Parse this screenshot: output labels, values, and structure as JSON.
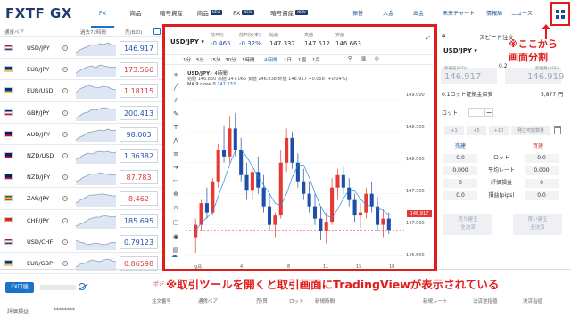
{
  "brand": {
    "logo": "FXTF GX"
  },
  "nav": {
    "tabs": [
      {
        "label": "FX",
        "badge": ""
      },
      {
        "label": "商品",
        "badge": ""
      },
      {
        "label": "暗号資産",
        "badge": ""
      },
      {
        "label": "商品",
        "badge": "NEW"
      },
      {
        "label": "FX",
        "badge": "NEW"
      },
      {
        "label": "暗号資産",
        "badge": "NEW"
      }
    ],
    "right_links": [
      "振替",
      "入金",
      "出金",
      "未来チャート",
      "情報局",
      "ニュース"
    ]
  },
  "rate_list": {
    "headers": {
      "pair": "通貨ペア",
      "chart": "過去72時間",
      "bid": "売(BID)"
    },
    "rows": [
      {
        "pair": "USD/JPY",
        "price": "146.917",
        "dir": "up",
        "flag": "us",
        "spark": [
          3,
          6,
          8,
          10,
          12,
          11,
          13,
          12,
          14,
          11,
          12
        ]
      },
      {
        "pair": "EUR/JPY",
        "price": "173.566",
        "dir": "dn",
        "flag": "eu",
        "spark": [
          4,
          7,
          9,
          11,
          12,
          10,
          13,
          12,
          11,
          10,
          11
        ]
      },
      {
        "pair": "EUR/USD",
        "price": "1.18115",
        "dir": "dn",
        "flag": "eu",
        "spark": [
          6,
          10,
          12,
          14,
          13,
          11,
          12,
          13,
          12,
          10,
          9
        ]
      },
      {
        "pair": "GBP/JPY",
        "price": "200.413",
        "dir": "up",
        "flag": "gb",
        "spark": [
          3,
          5,
          8,
          9,
          12,
          11,
          13,
          14,
          13,
          12,
          13
        ]
      },
      {
        "pair": "AUD/JPY",
        "price": "98.003",
        "dir": "up",
        "flag": "au",
        "spark": [
          2,
          5,
          7,
          10,
          11,
          12,
          13,
          12,
          14,
          12,
          13
        ]
      },
      {
        "pair": "NZD/USD",
        "price": "1.36382",
        "dir": "up",
        "flag": "nz",
        "spark": [
          4,
          6,
          9,
          11,
          10,
          12,
          13,
          12,
          13,
          11,
          12
        ]
      },
      {
        "pair": "NZD/JPY",
        "price": "87.783",
        "dir": "dn",
        "flag": "nz",
        "spark": [
          3,
          5,
          8,
          10,
          12,
          11,
          13,
          12,
          11,
          10,
          11
        ]
      },
      {
        "pair": "ZAR/JPY",
        "price": "8.462",
        "dir": "dn",
        "flag": "za",
        "spark": [
          3,
          6,
          8,
          11,
          12,
          12,
          13,
          13,
          12,
          11,
          11
        ]
      },
      {
        "pair": "CHF/JPY",
        "price": "185.695",
        "dir": "up",
        "flag": "ch",
        "spark": [
          2,
          4,
          6,
          9,
          11,
          12,
          12,
          14,
          13,
          12,
          13
        ]
      },
      {
        "pair": "USD/CHF",
        "price": "0.79123",
        "dir": "up",
        "flag": "us",
        "spark": [
          10,
          8,
          7,
          5,
          6,
          7,
          6,
          5,
          6,
          8,
          7
        ]
      },
      {
        "pair": "EUR/GBP",
        "price": "0.86598",
        "dir": "dn",
        "flag": "eu",
        "spark": [
          4,
          7,
          8,
          10,
          12,
          11,
          10,
          12,
          13,
          11,
          10
        ]
      }
    ]
  },
  "account": {
    "button": "FX口座",
    "valuation_label": "評価損益",
    "valuation_value": "********"
  },
  "bottom_table": {
    "tab": "ポジ",
    "headers": [
      "注文番号",
      "通貨ペア",
      "売/買",
      "ロット",
      "新規時間",
      "新規レート",
      "決済逆指値",
      "決済指値"
    ]
  },
  "chart_header": {
    "pair": "USD/JPY",
    "labels": [
      "前日比",
      "前日比(率)",
      "始値",
      "高値",
      "安値"
    ],
    "values": [
      "-0.465",
      "-0.32%",
      "147.337",
      "147.512",
      "146.663"
    ]
  },
  "timeframes": [
    "1分",
    "5分",
    "15分",
    "30分",
    "1時間",
    "4時間",
    "1日",
    "1週",
    "1月"
  ],
  "selected_timeframe": "4時間",
  "chart_legend": {
    "title": "USD/JPY",
    "interval": "4時間",
    "ohlc": "始値 146.860  高値 147.065  安値 146.838  終値 146.917  +0.058 (+0.04%)",
    "ma": "MA 9 close 0",
    "ma_value": "147.233"
  },
  "chart_data": {
    "type": "candlestick",
    "title": "USD/JPY 4時間",
    "ylim": [
      146.45,
      149.1
    ],
    "y_ticks": [
      "149.000",
      "148.500",
      "148.000",
      "147.500",
      "147.000",
      "146.500"
    ],
    "x_ticks": [
      "9月",
      "4",
      "8",
      "11",
      "15",
      "18"
    ],
    "last_price": "146.917",
    "candles": [
      {
        "o": 146.8,
        "h": 147.1,
        "l": 146.55,
        "c": 147.0
      },
      {
        "o": 147.0,
        "h": 147.4,
        "l": 146.9,
        "c": 147.35
      },
      {
        "o": 147.35,
        "h": 147.6,
        "l": 147.1,
        "c": 147.2
      },
      {
        "o": 147.2,
        "h": 147.75,
        "l": 147.15,
        "c": 147.7
      },
      {
        "o": 147.7,
        "h": 148.3,
        "l": 147.6,
        "c": 148.2
      },
      {
        "o": 148.2,
        "h": 148.6,
        "l": 148.0,
        "c": 148.1
      },
      {
        "o": 148.1,
        "h": 148.75,
        "l": 148.0,
        "c": 148.55
      },
      {
        "o": 148.55,
        "h": 148.8,
        "l": 148.1,
        "c": 148.2
      },
      {
        "o": 148.2,
        "h": 148.4,
        "l": 147.7,
        "c": 147.8
      },
      {
        "o": 147.8,
        "h": 148.0,
        "l": 147.4,
        "c": 147.55
      },
      {
        "o": 147.55,
        "h": 147.9,
        "l": 147.4,
        "c": 147.85
      },
      {
        "o": 147.85,
        "h": 148.1,
        "l": 147.5,
        "c": 147.6
      },
      {
        "o": 147.6,
        "h": 147.8,
        "l": 147.2,
        "c": 147.3
      },
      {
        "o": 147.3,
        "h": 147.5,
        "l": 146.9,
        "c": 147.0
      },
      {
        "o": 147.0,
        "h": 147.2,
        "l": 146.8,
        "c": 147.15
      },
      {
        "o": 147.15,
        "h": 148.2,
        "l": 147.1,
        "c": 148.0
      },
      {
        "o": 148.0,
        "h": 148.55,
        "l": 147.85,
        "c": 148.4
      },
      {
        "o": 148.4,
        "h": 148.5,
        "l": 147.9,
        "c": 148.0
      },
      {
        "o": 148.0,
        "h": 148.15,
        "l": 147.6,
        "c": 147.7
      },
      {
        "o": 147.7,
        "h": 147.9,
        "l": 147.4,
        "c": 147.5
      },
      {
        "o": 147.5,
        "h": 147.7,
        "l": 147.2,
        "c": 147.3
      },
      {
        "o": 147.3,
        "h": 147.5,
        "l": 147.0,
        "c": 147.1
      },
      {
        "o": 147.1,
        "h": 147.3,
        "l": 146.75,
        "c": 146.9
      },
      {
        "o": 146.9,
        "h": 147.2,
        "l": 146.7,
        "c": 147.05
      },
      {
        "o": 147.05,
        "h": 147.75,
        "l": 147.0,
        "c": 147.6
      },
      {
        "o": 147.6,
        "h": 147.9,
        "l": 147.4,
        "c": 147.8
      },
      {
        "o": 147.8,
        "h": 147.95,
        "l": 147.5,
        "c": 147.6
      },
      {
        "o": 147.6,
        "h": 147.75,
        "l": 147.3,
        "c": 147.4
      },
      {
        "o": 147.4,
        "h": 147.5,
        "l": 147.05,
        "c": 147.15
      },
      {
        "o": 147.15,
        "h": 147.35,
        "l": 146.95,
        "c": 147.2
      },
      {
        "o": 147.2,
        "h": 147.6,
        "l": 147.1,
        "c": 147.5
      },
      {
        "o": 147.5,
        "h": 147.7,
        "l": 147.2,
        "c": 147.3
      },
      {
        "o": 147.3,
        "h": 147.45,
        "l": 146.9,
        "c": 147.0
      },
      {
        "o": 147.0,
        "h": 147.25,
        "l": 146.8,
        "c": 147.1
      },
      {
        "o": 147.1,
        "h": 147.2,
        "l": 146.85,
        "c": 146.92
      }
    ]
  },
  "annotations": {
    "right": [
      "※ここから",
      "画面分割"
    ],
    "bottom": "※取引ツールを開くと取引画面にTradingViewが表示されている"
  },
  "order_panel": {
    "title": "スピード注文",
    "pair": "USD/JPY",
    "amount": "0.2",
    "sell_label": "新規売(BID)",
    "buy_label": "新規買(ASK)",
    "sell_price": "146.917",
    "buy_price": "146.919",
    "margin_label": "0.1ロット証拠金目安",
    "margin_value": "5,877 円",
    "lot_label": "ロット",
    "chips": [
      "+1",
      "+5",
      "+10",
      "発注可能数量"
    ],
    "sell_head": "売建",
    "buy_head": "買建",
    "rows": [
      {
        "sell": "0.0",
        "label": "ロット",
        "buy": "0.0"
      },
      {
        "sell": "0.000",
        "label": "平均レート",
        "buy": "0.000"
      },
      {
        "sell": "0",
        "label": "評価損益",
        "buy": "0"
      },
      {
        "sell": "0.0",
        "label": "損益(pips)",
        "buy": "0.0"
      }
    ],
    "close_sell": [
      "売り建玉",
      "全決済"
    ],
    "close_buy": [
      "買い建玉",
      "全決済"
    ]
  }
}
